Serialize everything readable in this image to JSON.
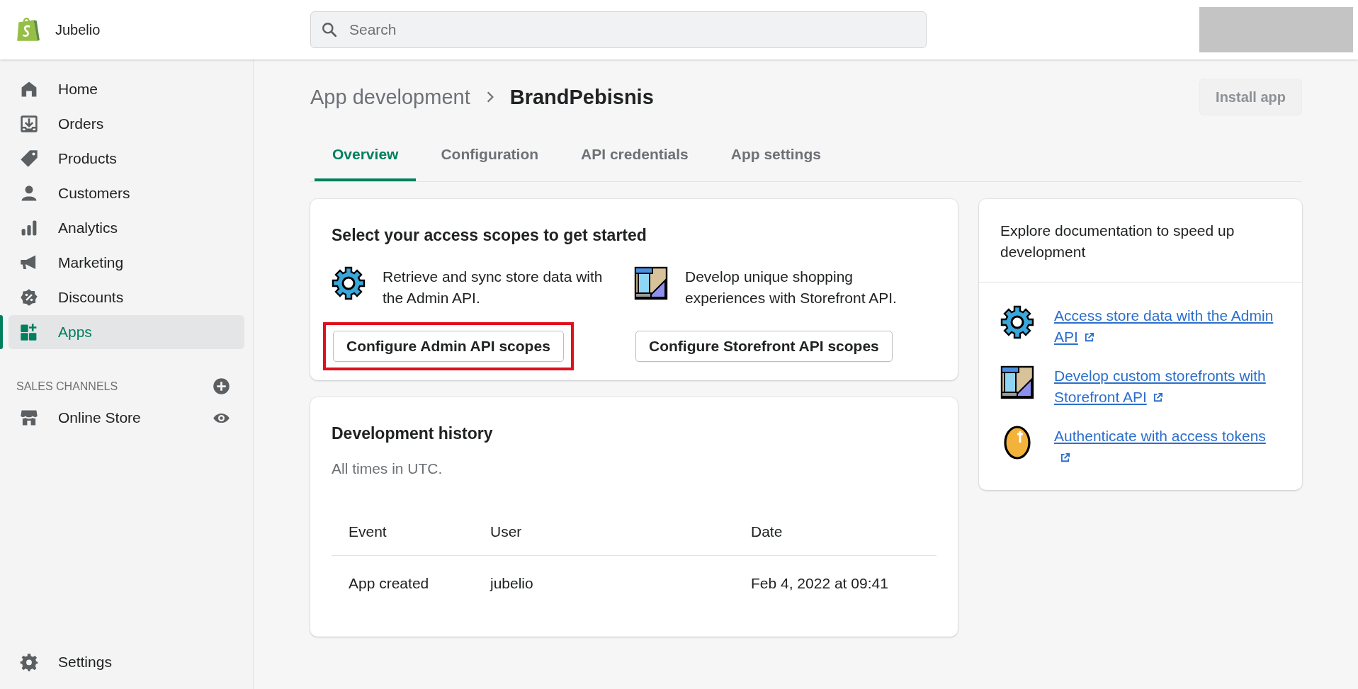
{
  "header": {
    "store_name": "Jubelio",
    "search": {
      "placeholder": "Search"
    }
  },
  "sidebar": {
    "items": [
      {
        "label": "Home",
        "kind": "home",
        "selected": false
      },
      {
        "label": "Orders",
        "kind": "orders",
        "selected": false
      },
      {
        "label": "Products",
        "kind": "tag",
        "selected": false
      },
      {
        "label": "Customers",
        "kind": "person",
        "selected": false
      },
      {
        "label": "Analytics",
        "kind": "bars",
        "selected": false
      },
      {
        "label": "Marketing",
        "kind": "megaphone",
        "selected": false
      },
      {
        "label": "Discounts",
        "kind": "discount",
        "selected": false
      },
      {
        "label": "Apps",
        "kind": "apps",
        "selected": true
      }
    ],
    "sales_channels": {
      "heading": "SALES CHANNELS",
      "items": [
        {
          "label": "Online Store"
        }
      ]
    },
    "settings": {
      "label": "Settings"
    }
  },
  "page": {
    "breadcrumb": "App development",
    "title": "BrandPebisnis",
    "install_button": {
      "label": "Install app",
      "disabled": true
    }
  },
  "tabs": [
    {
      "label": "Overview",
      "selected": true
    },
    {
      "label": "Configuration",
      "selected": false
    },
    {
      "label": "API credentials",
      "selected": false
    },
    {
      "label": "App settings",
      "selected": false
    }
  ],
  "scopes_card": {
    "title": "Select your access scopes to get started",
    "options": [
      {
        "kind": "gear",
        "description": "Retrieve and sync store data with the Admin API.",
        "button": "Configure Admin API scopes",
        "highlighted": true
      },
      {
        "kind": "storefront",
        "description": "Develop unique shopping experiences with Storefront API.",
        "button": "Configure Storefront API scopes",
        "highlighted": false
      }
    ]
  },
  "history_card": {
    "title": "Development history",
    "subtitle": "All times in UTC.",
    "columns": [
      "Event",
      "User",
      "Date"
    ],
    "rows": [
      [
        "App created",
        "jubelio",
        "Feb 4, 2022 at 09:41"
      ]
    ]
  },
  "docs_card": {
    "title": "Explore documentation to speed up development",
    "links": [
      {
        "kind": "gear",
        "label": "Access store data with the Admin API"
      },
      {
        "kind": "storefront",
        "label": "Develop custom storefronts with Storefront API"
      },
      {
        "kind": "coin",
        "label": "Authenticate with access tokens"
      }
    ]
  }
}
